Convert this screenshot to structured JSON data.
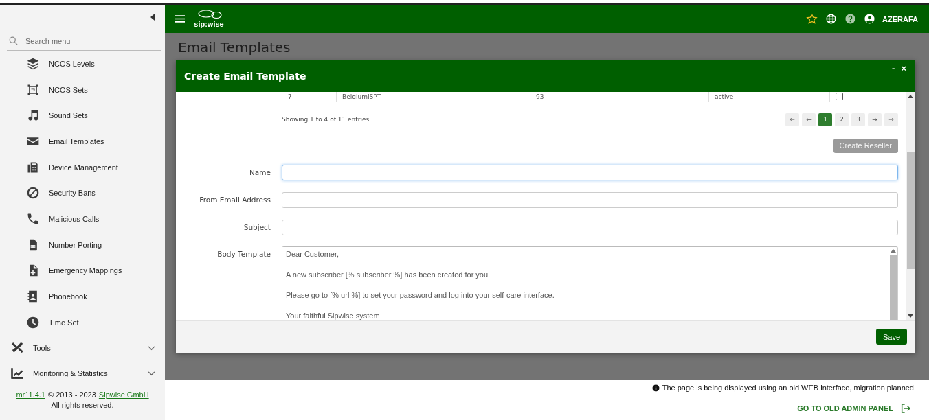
{
  "sidebar": {
    "search": {
      "placeholder": "Search menu"
    },
    "items": [
      {
        "label": "NCOS Levels",
        "selected": false
      },
      {
        "label": "NCOS Sets",
        "selected": false
      },
      {
        "label": "Sound Sets",
        "selected": false
      },
      {
        "label": "Email Templates",
        "selected": false
      },
      {
        "label": "Device Management",
        "selected": false
      },
      {
        "label": "Security Bans",
        "selected": false
      },
      {
        "label": "Malicious Calls",
        "selected": false
      },
      {
        "label": "Number Porting",
        "selected": false
      },
      {
        "label": "Emergency Mappings",
        "selected": false
      },
      {
        "label": "Phonebook",
        "selected": false
      },
      {
        "label": "Time Set",
        "selected": false
      }
    ],
    "groups": [
      {
        "label": "Tools",
        "expanded": false
      },
      {
        "label": "Monitoring & Statistics",
        "expanded": false
      }
    ],
    "footer": {
      "version": "mr11.4.1",
      "copyright": "© 2013 - 2023",
      "company": "Sipwise GmbH",
      "rights": "All rights reserved."
    }
  },
  "header": {
    "logo": "sip:wise",
    "user": "AZERAFA"
  },
  "page_title": "Email Templates",
  "dialog": {
    "title": "Create Email Template",
    "minimize": "-",
    "close": "×",
    "table_row": {
      "cells": [
        "7",
        "BelgiumISPT",
        "93",
        "active"
      ],
      "checked": false
    },
    "entries_info": "Showing 1 to 4 of 11 entries",
    "pagination": [
      {
        "label": "⇐",
        "selected": false
      },
      {
        "label": "←",
        "selected": false
      },
      {
        "label": "1",
        "selected": true
      },
      {
        "label": "2",
        "selected": false
      },
      {
        "label": "3",
        "selected": false
      },
      {
        "label": "→",
        "selected": false
      },
      {
        "label": "⇒",
        "selected": false
      }
    ],
    "create_button": {
      "label": "Create Reseller",
      "disabled": true
    },
    "fields": [
      {
        "label": "Name",
        "focused": true
      },
      {
        "label": "From Email Address",
        "focused": false
      },
      {
        "label": "Subject",
        "focused": false
      }
    ],
    "body_template": {
      "label": "Body Template",
      "lines": [
        "Dear Customer,",
        "A new subscriber [% subscriber %] has been created for you.",
        "Please go to [% url %] to set your password and log into your self-care interface.",
        "Your faithful Sipwise system"
      ]
    },
    "save_button": "Save"
  },
  "notice": "The page is being displayed using an old WEB interface, migration planned",
  "old_panel_link": "GO TO OLD ADMIN PANEL"
}
